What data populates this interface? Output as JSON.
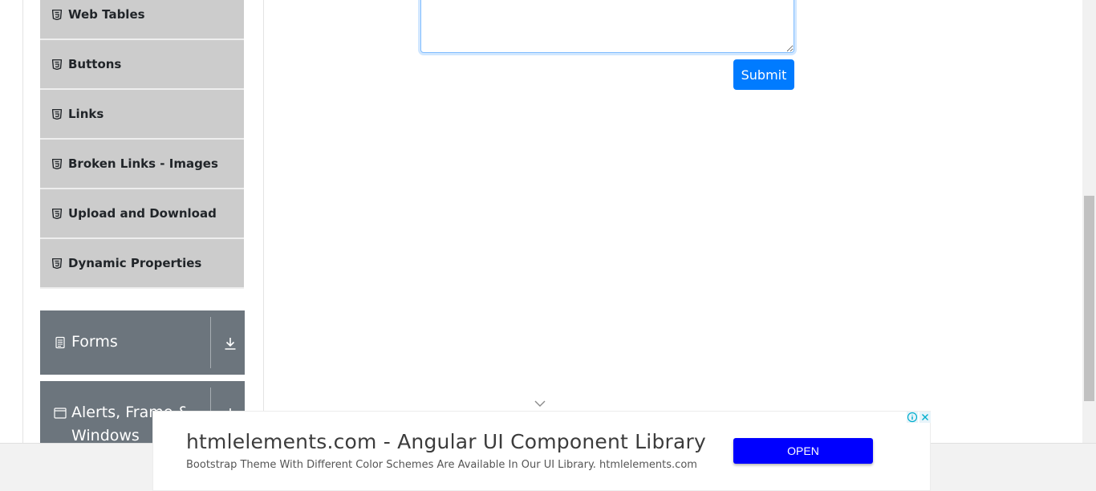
{
  "sidebar": {
    "elements_items": [
      {
        "label": "Web Tables",
        "icon": "html5-icon"
      },
      {
        "label": "Buttons",
        "icon": "html5-icon"
      },
      {
        "label": "Links",
        "icon": "html5-icon"
      },
      {
        "label": "Broken Links - Images",
        "icon": "html5-icon"
      },
      {
        "label": "Upload and Download",
        "icon": "html5-icon"
      },
      {
        "label": "Dynamic Properties",
        "icon": "html5-icon"
      }
    ],
    "groups": [
      {
        "label": "Forms",
        "icon": "form-icon",
        "toggle_icon": "download-arrow-icon"
      },
      {
        "label_line1": "Alerts, Frame &",
        "label_line2": "Windows",
        "icon": "window-icon",
        "toggle_icon": "download-arrow-icon"
      }
    ]
  },
  "form": {
    "submit_label": "Submit"
  },
  "ad": {
    "headline": "htmlelements.com - Angular UI Component Library",
    "description": "Bootstrap Theme With Different Color Schemes Are Available In Our UI Library. htmlelements.com",
    "cta_label": "OPEN",
    "cta_color": "#0000ff"
  },
  "colors": {
    "accent": "#007bff",
    "sidebar_item_bg": "#cccccc",
    "group_bg": "#6c757d"
  }
}
